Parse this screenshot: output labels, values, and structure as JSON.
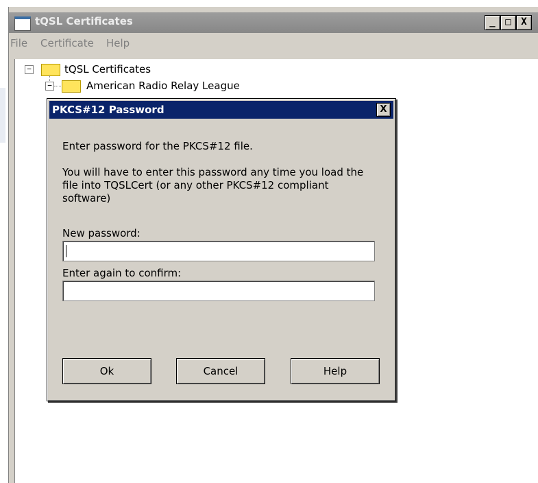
{
  "main_window": {
    "title": "tQSL Certificates",
    "controls": {
      "minimize": "_",
      "maximize": "□",
      "close": "X"
    },
    "menu": [
      "File",
      "Certificate",
      "Help"
    ]
  },
  "tree": {
    "root": {
      "label": "tQSL Certificates",
      "toggle": "−"
    },
    "child": {
      "label": "American Radio Relay League",
      "toggle": "−"
    }
  },
  "dialog": {
    "title": "PKCS#12 Password",
    "close": "X",
    "intro": "Enter password for the PKCS#12 file.",
    "notice": "You will have to enter this password any time you load the file into TQSLCert (or any other PKCS#12 compliant software)",
    "new_password_label": "New password:",
    "new_password_value": "",
    "confirm_label": "Enter again to confirm:",
    "confirm_value": "",
    "buttons": {
      "ok": "Ok",
      "cancel": "Cancel",
      "help": "Help"
    }
  }
}
